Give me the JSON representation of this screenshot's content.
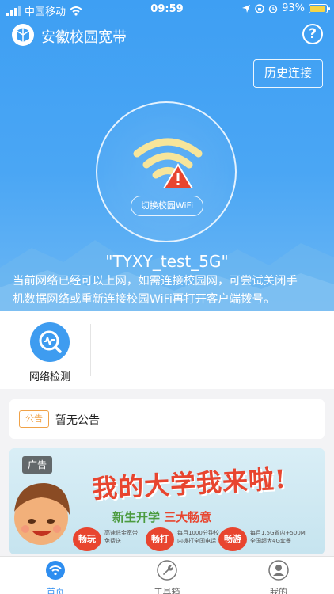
{
  "status_bar": {
    "carrier": "中国移动",
    "time": "09:59",
    "battery": "93%"
  },
  "header": {
    "title": "安徽校园宽带",
    "history_button": "历史连接"
  },
  "wifi": {
    "switch_button": "切换校园WiFi",
    "ssid": "\"TYXY_test_5G\"",
    "hint_line1": "当前网络已经可以上网，如需连接校园网，可尝试关闭手",
    "hint_line2": "机数据网络或重新连接校园WiFi再打开客户端拨号。"
  },
  "features": [
    {
      "label": "网络检测",
      "icon": "search-wave-icon"
    }
  ],
  "notice": {
    "tag": "公告",
    "text": "暂无公告"
  },
  "banner": {
    "tag": "广告",
    "headline": "我的大学我来啦!",
    "sub_plain": "新生开学",
    "sub_highlight": "三大畅意",
    "pills": [
      {
        "label": "畅玩",
        "desc1": "高速低金宽带",
        "desc2": "免费送"
      },
      {
        "label": "畅打",
        "desc1": "每月1000分钟校",
        "desc2": "内拨打全国电话"
      },
      {
        "label": "畅游",
        "desc1": "每月1.5G省内+500M",
        "desc2": "全国超大4G套餐"
      }
    ]
  },
  "tabbar": {
    "tabs": [
      {
        "label": "首页",
        "icon": "wifi-home-icon",
        "active": true
      },
      {
        "label": "工具箱",
        "icon": "wrench-icon",
        "active": false
      },
      {
        "label": "我的",
        "icon": "user-icon",
        "active": false
      }
    ]
  },
  "colors": {
    "primary": "#3e9ff3",
    "accent_orange": "#f0a248",
    "banner_red": "#e8452f",
    "tab_active": "#2e8ef0"
  }
}
